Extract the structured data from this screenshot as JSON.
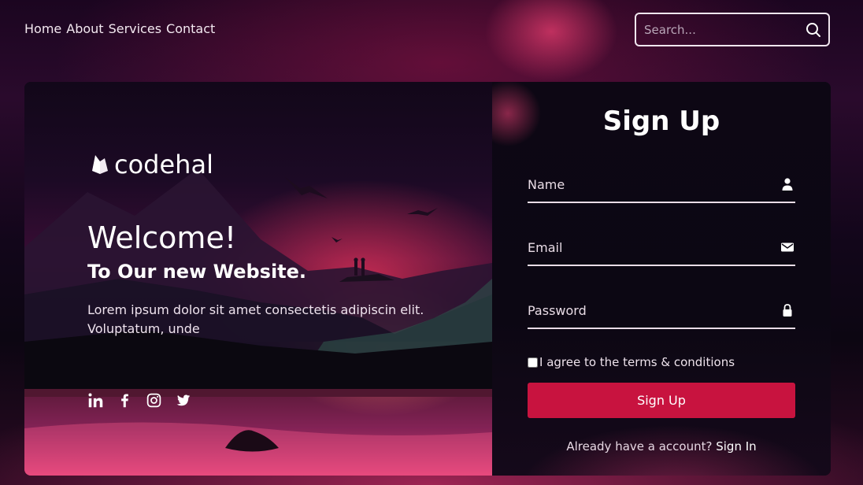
{
  "nav": {
    "links": [
      "Home",
      "About",
      "Services",
      "Contact"
    ]
  },
  "search": {
    "placeholder": "Search...",
    "icon": "search-icon"
  },
  "brand": {
    "name": "codehal",
    "icon": "codehal-logo-icon"
  },
  "hero": {
    "welcome": "Welcome!",
    "subtitle": "To Our new Website.",
    "description": "Lorem ipsum dolor sit amet consectetis adipiscin elit. Voluptatum, unde",
    "socials": [
      "linkedin-icon",
      "facebook-icon",
      "instagram-icon",
      "twitter-icon"
    ]
  },
  "form": {
    "title": "Sign Up",
    "name_placeholder": "Name",
    "email_placeholder": "Email",
    "password_placeholder": "Password",
    "agree_text": "I agree to the terms & conditions",
    "submit_label": "Sign Up",
    "have_account_text": "Already have a account?",
    "signin_link": "Sign In"
  },
  "colors": {
    "accent": "#c8133f",
    "background": "#12061a"
  }
}
